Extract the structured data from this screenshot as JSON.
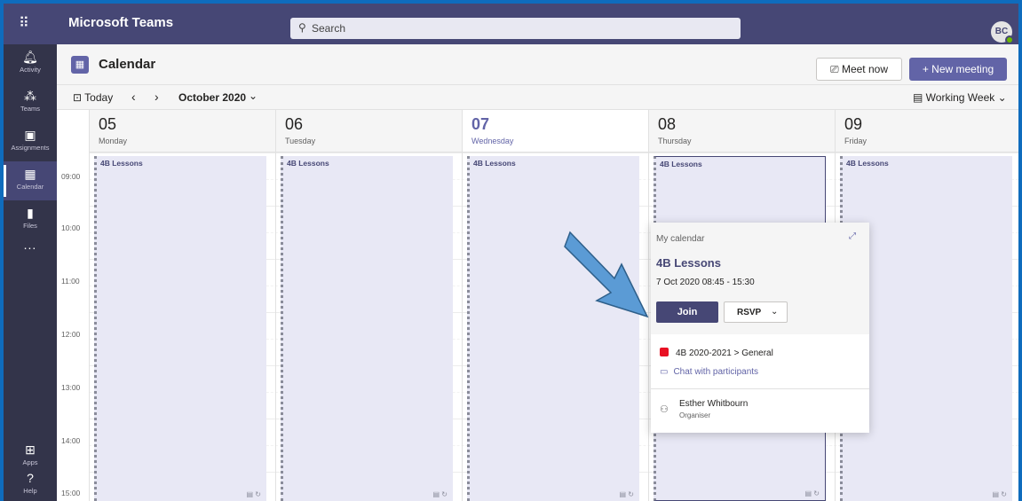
{
  "titlebar": {
    "app_title": "Microsoft Teams",
    "search_placeholder": "Search",
    "avatar_initials": "BC"
  },
  "rail": {
    "items": [
      {
        "label": "Activity",
        "icon": "bell-icon"
      },
      {
        "label": "Teams",
        "icon": "teams-icon"
      },
      {
        "label": "Assignments",
        "icon": "assignments-icon"
      },
      {
        "label": "Calendar",
        "icon": "calendar-icon",
        "active": true
      },
      {
        "label": "Files",
        "icon": "files-icon"
      }
    ],
    "more": "...",
    "bottom": [
      {
        "label": "Apps",
        "icon": "apps-icon"
      },
      {
        "label": "Help",
        "icon": "help-icon"
      }
    ]
  },
  "header": {
    "title": "Calendar",
    "meet_now": "Meet now",
    "new_meeting": "+ New meeting"
  },
  "nav": {
    "today": "Today",
    "month": "October 2020",
    "view": "Working Week"
  },
  "days": [
    {
      "num": "05",
      "name": "Monday"
    },
    {
      "num": "06",
      "name": "Tuesday"
    },
    {
      "num": "07",
      "name": "Wednesday",
      "today": true
    },
    {
      "num": "08",
      "name": "Thursday"
    },
    {
      "num": "09",
      "name": "Friday"
    }
  ],
  "times": [
    "09:00",
    "10:00",
    "11:00",
    "12:00",
    "13:00",
    "14:00",
    "15:00"
  ],
  "event_label": "4B Lessons",
  "popup": {
    "calendar": "My calendar",
    "title": "4B Lessons",
    "time": "7 Oct 2020 08:45 - 15:30",
    "join": "Join",
    "rsvp": "RSVP",
    "channel": "4B 2020-2021 > General",
    "chat": "Chat with participants",
    "organiser_name": "Esther Whitbourn",
    "organiser_role": "Organiser"
  },
  "colors": {
    "brand": "#464775",
    "accent": "#6264a7",
    "rail": "#33344a",
    "event_bg": "#e8e8f5",
    "arrow": "#5b9bd5"
  }
}
